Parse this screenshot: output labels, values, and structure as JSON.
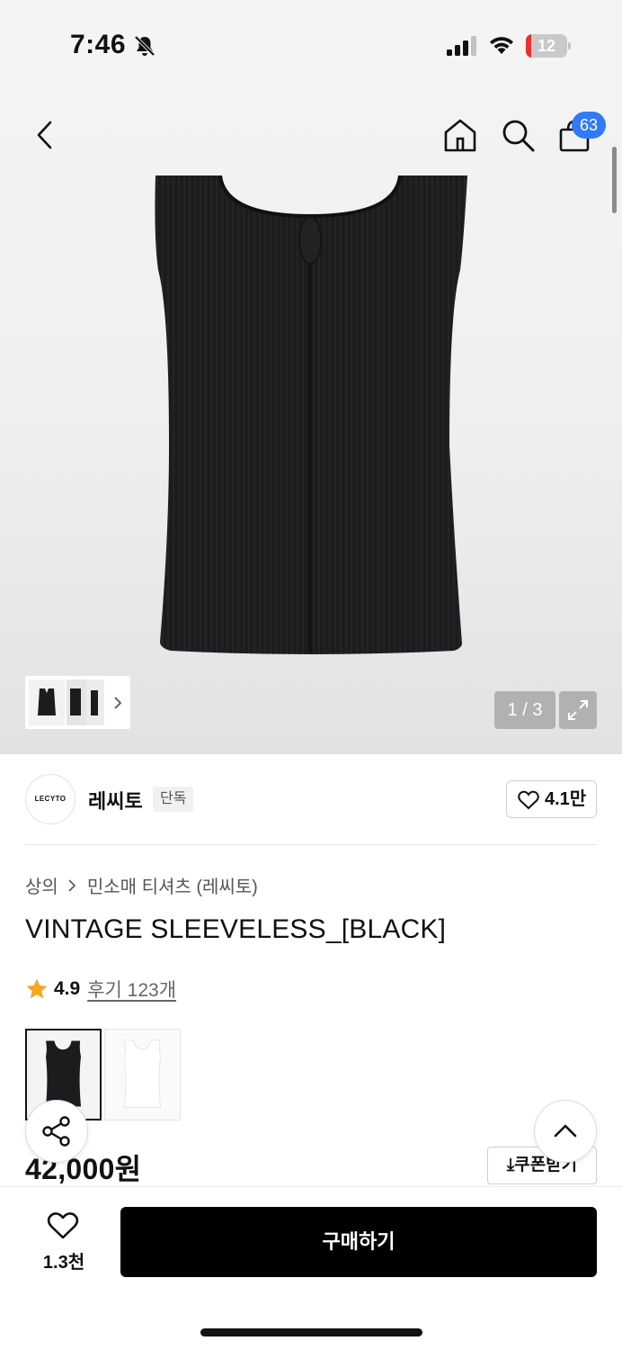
{
  "status_bar": {
    "time": "7:46",
    "battery_level": "12",
    "battery_fraction": 0.12,
    "icons": [
      "bell-slash-icon",
      "cellular-signal-icon",
      "wifi-icon",
      "battery-icon"
    ]
  },
  "header": {
    "icons": [
      "back-arrow-icon",
      "home-icon",
      "search-icon",
      "shopping-bag-icon"
    ],
    "cart_count": "63"
  },
  "gallery": {
    "page_indicator": "1 / 3",
    "current_page": 1,
    "total_pages": 3,
    "product_color": "#1c1c1e"
  },
  "brand": {
    "logo_text": "LECYTO",
    "name": "레씨토",
    "badge": "단독",
    "like_count": "4.1만"
  },
  "product": {
    "breadcrumb": [
      "상의",
      "민소매 티셔츠 (레씨토)"
    ],
    "title": "VINTAGE SLEEVELESS_[BLACK]",
    "rating": "4.9",
    "review_link": "후기 123개",
    "price": "42,000원",
    "coupon_button": "쿠폰받기",
    "color_options": [
      {
        "color": "#1a1a1a",
        "selected": true
      },
      {
        "color": "#ffffff",
        "selected": false
      }
    ]
  },
  "bottom_bar": {
    "wish_count": "1.3천",
    "buy_button": "구매하기"
  },
  "colors": {
    "accent_badge": "#2f7bf6",
    "star": "#f5a623",
    "battery_low": "#e9312f"
  }
}
